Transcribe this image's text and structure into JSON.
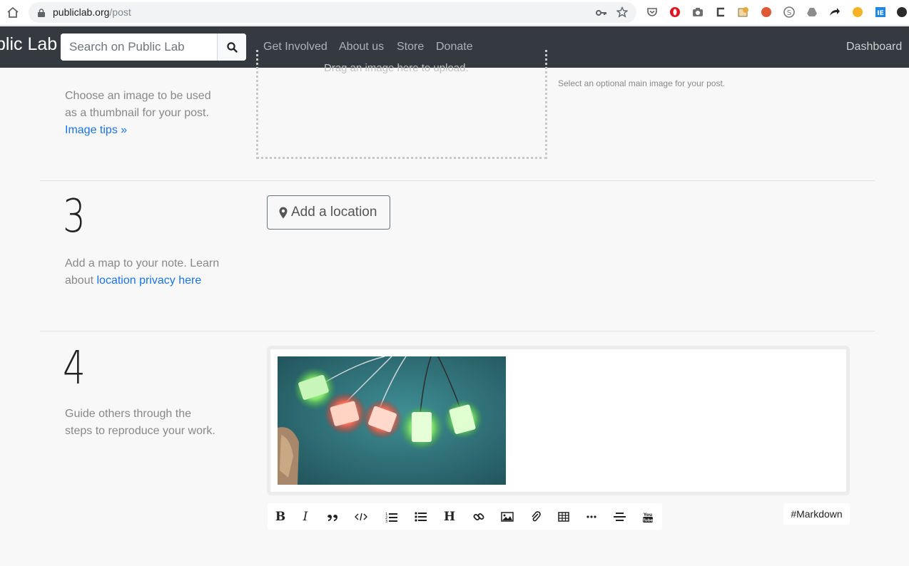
{
  "browser": {
    "url_host": "publiclab.org",
    "url_path": "/post",
    "extensions": [
      "pocket-icon",
      "opera-icon",
      "camera-icon",
      "c-icon",
      "puzzle-icon",
      "duckduckgo-icon",
      "skype-icon",
      "drive-icon",
      "arrow-icon",
      "coin-icon",
      "ie-icon",
      "menu-icon"
    ]
  },
  "navbar": {
    "brand": "blic Lab",
    "search_placeholder": "Search on Public Lab",
    "links": [
      "Get Involved",
      "About us",
      "Store",
      "Donate"
    ],
    "dashboard": "Dashboard"
  },
  "step2": {
    "drop_text": "Drag an image here to upload.",
    "help_line1": "Choose an image to be used",
    "help_line2": "as a thumbnail for your post.",
    "help_link": "Image tips »",
    "side_note": "Select an optional main image for your post."
  },
  "step3": {
    "number": "3",
    "button_label": "Add a location",
    "help_line1": "Add a map to your note. Learn",
    "help_pre": "about ",
    "help_link": "location privacy here"
  },
  "step4": {
    "number": "4",
    "help_line1": "Guide others through the",
    "help_line2": "steps to reproduce your work.",
    "markdown_badge": "#Markdown",
    "toolbar_icons": [
      "bold-icon",
      "italic-icon",
      "quote-icon",
      "code-icon",
      "ordered-list-icon",
      "unordered-list-icon",
      "heading-icon",
      "link-icon",
      "image-icon",
      "attachment-icon",
      "table-icon",
      "horizontal-rule-icon",
      "center-align-icon",
      "youtube-icon"
    ]
  },
  "colors": {
    "navbar": "#343a40",
    "link": "#1a73e8",
    "page_bg": "#f8f8f8"
  }
}
